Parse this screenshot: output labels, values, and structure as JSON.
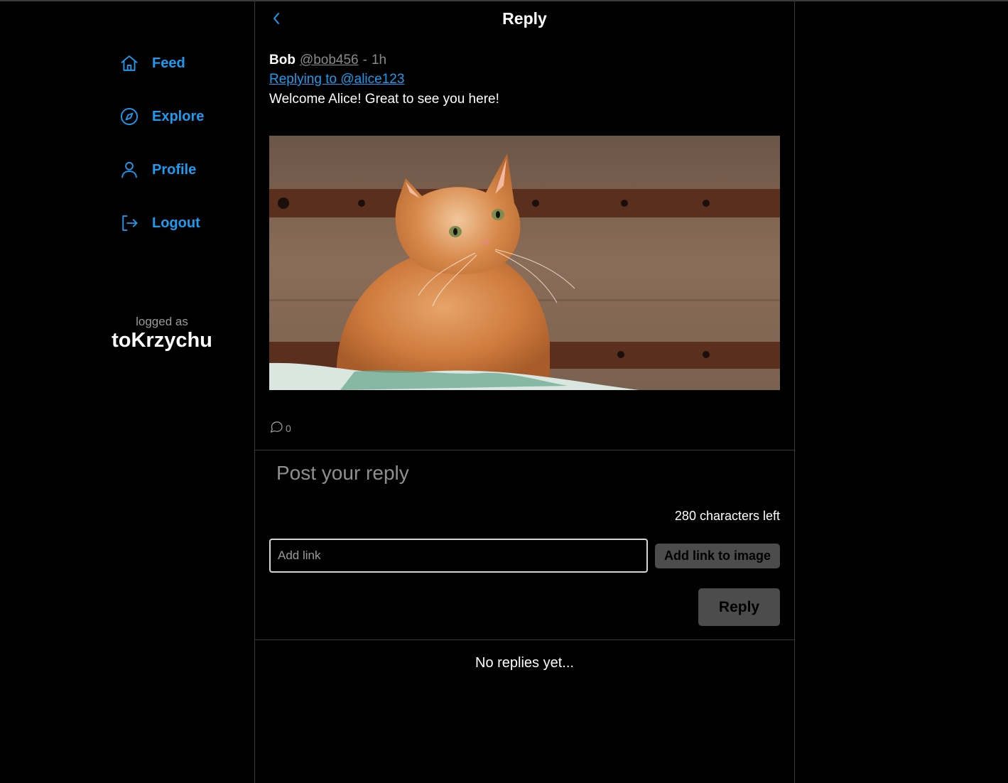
{
  "sidebar": {
    "items": [
      {
        "label": "Feed",
        "icon": "home-icon"
      },
      {
        "label": "Explore",
        "icon": "compass-icon"
      },
      {
        "label": "Profile",
        "icon": "user-icon"
      },
      {
        "label": "Logout",
        "icon": "logout-icon"
      }
    ],
    "logged_label": "logged as",
    "username": "toKrzychu"
  },
  "header": {
    "title": "Reply",
    "back_icon": "chevron-left-icon"
  },
  "post": {
    "author": "Bob",
    "handle": "@bob456",
    "separator": "-",
    "time": "1h",
    "replying_to": "Replying to @alice123",
    "text": "Welcome Alice! Great to see you here!",
    "image": "orange-cat-photo",
    "reply_count": "0"
  },
  "composer": {
    "placeholder": "Post your reply",
    "chars_left": "280 characters left",
    "link_placeholder": "Add link",
    "add_link_label": "Add link to image",
    "reply_label": "Reply"
  },
  "replies": {
    "empty_text": "No replies yet..."
  },
  "colors": {
    "accent": "#1d9bf0",
    "background": "#000000",
    "border": "#3a3a3a",
    "muted": "#8a8a8a",
    "button_bg": "#4c4c4c"
  }
}
